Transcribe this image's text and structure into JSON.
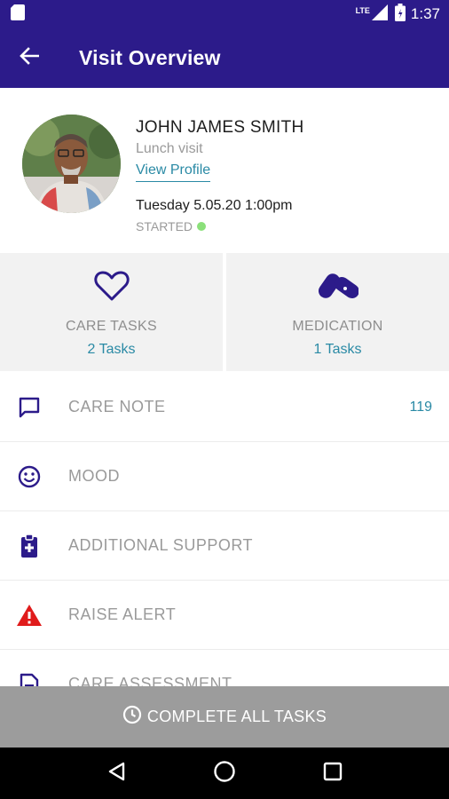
{
  "status_bar": {
    "time": "1:37",
    "network": "LTE",
    "icons": [
      "sim-card-icon",
      "signal-icon",
      "battery-icon"
    ]
  },
  "app_bar": {
    "title": "Visit Overview",
    "back_icon": "arrow-back-icon"
  },
  "profile": {
    "name": "JOHN JAMES SMITH",
    "visit_type": "Lunch visit",
    "view_profile_label": "View Profile",
    "datetime": "Tuesday 5.05.20 1:00pm",
    "status": "STARTED",
    "status_color": "#8be07a"
  },
  "tiles": [
    {
      "label": "CARE TASKS",
      "count": "2 Tasks",
      "icon": "heart-icon"
    },
    {
      "label": "MEDICATION",
      "count": "1 Tasks",
      "icon": "pills-icon"
    }
  ],
  "menu": [
    {
      "label": "CARE NOTE",
      "count": "119",
      "icon": "chat-bubble-icon"
    },
    {
      "label": "MOOD",
      "count": "",
      "icon": "smiley-icon"
    },
    {
      "label": "ADDITIONAL SUPPORT",
      "count": "",
      "icon": "medical-clipboard-icon"
    },
    {
      "label": "RAISE ALERT",
      "count": "",
      "icon": "warning-icon"
    },
    {
      "label": "CARE ASSESSMENT",
      "count": "",
      "icon": "document-icon"
    }
  ],
  "cta": {
    "label": "COMPLETE ALL TASKS",
    "icon": "clock-icon"
  },
  "nav_bar": {
    "icons": [
      "back-triangle-icon",
      "home-circle-icon",
      "recents-square-icon"
    ]
  },
  "colors": {
    "primary": "#2c1b8a",
    "accent_teal": "#2a8aa5",
    "alert_red": "#e01b1b",
    "cta_gray": "#9c9c9c"
  }
}
